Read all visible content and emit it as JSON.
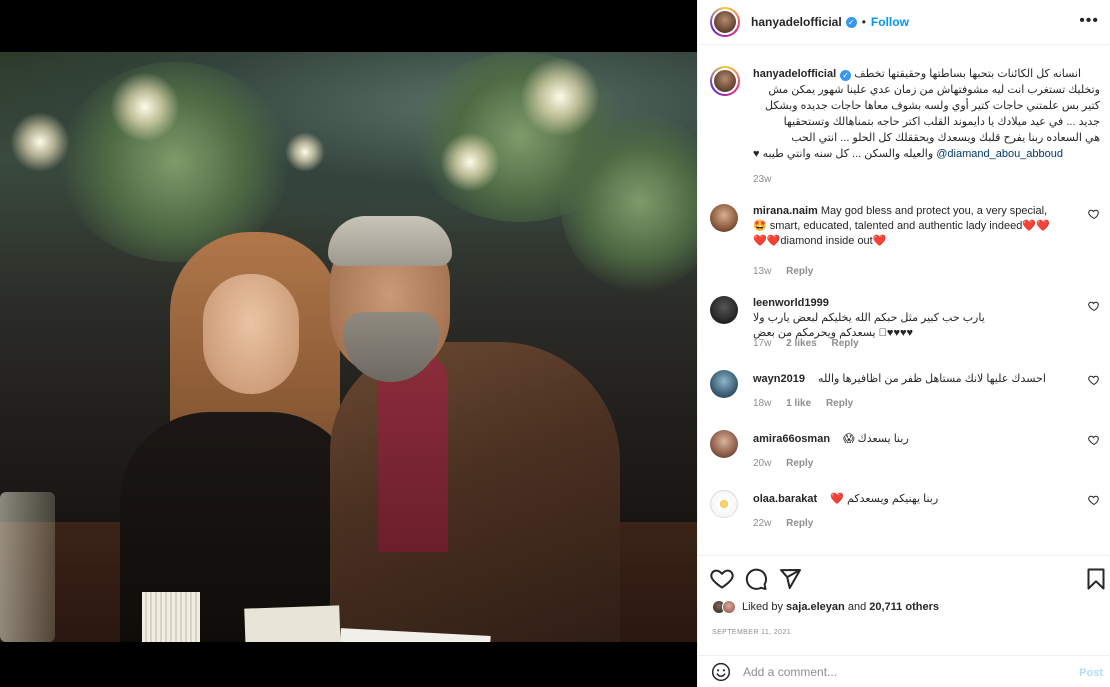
{
  "post": {
    "username": "hanyadelofficial",
    "follow_label": "Follow",
    "separator": "•",
    "more_label": "•••",
    "verified_mark": "✓"
  },
  "caption": {
    "username": "hanyadelofficial",
    "lines": [
      "انسانه كل الكائنات بتحبها بساطتها وحقيقتها تخطف",
      "وتخليك تستغرب انت ليه مشوفتهاش من زمان عدي علينا شهور يمكن مش",
      "كتير بس علمتني حاجات كتير أوي ولسه بشوف معاها حاجات جديده وبشكل",
      "جديد ... في عيد ميلادك يا دايموند القلب اكتر حاجه بتمناهالك وتستحقيها",
      "هي السعاده ربنا يفرح قلبك ويسعدك ويحققلك كل الحلو ... انتي الحب"
    ],
    "last_line_text": "والعيله والسكن ... كل سنه وانتي طيبه ♥",
    "mention": "@diamand_abou_abboud",
    "time": "23w"
  },
  "comments": [
    {
      "username": "mirana.naim",
      "text_1": "May god bless and protect you, a very special,",
      "text_2": "🤩 smart, educated, talented and authentic lady indeed❤️❤️",
      "text_3": "❤️❤️diamond inside out❤️",
      "time": "13w",
      "likes": "",
      "reply": "Reply"
    },
    {
      "username": "leenworld1999",
      "text_1": "يارب حب كبير مثل حبكم الله يخليكم لبعض يارب ولا",
      "text_2": "♥♥♥♥🏻 يسعدكم ويحرمكم من بعض",
      "time": "17w",
      "likes": "2 likes",
      "reply": "Reply"
    },
    {
      "username": "wayn2019",
      "text_1": "احسدك عليها لانك مستاهل ظفر من اظافيرها والله",
      "time": "18w",
      "likes": "1 like",
      "reply": "Reply"
    },
    {
      "username": "amira66osman",
      "text_1": "ربنا يسعدك 😱",
      "time": "20w",
      "likes": "",
      "reply": "Reply"
    },
    {
      "username": "olaa.barakat",
      "text_1": "ربنا يهنيكم ويسعدكم ❤️",
      "time": "22w",
      "likes": "",
      "reply": "Reply"
    }
  ],
  "likes": {
    "prefix": "Liked by",
    "user": "saja.eleyan",
    "middle": "and",
    "count": "20,711 others"
  },
  "date": "SEPTEMBER 11, 2021",
  "add_comment": {
    "placeholder": "Add a comment...",
    "post_label": "Post"
  },
  "icons": {
    "like": "heart-icon",
    "comment": "comment-icon",
    "share": "share-icon",
    "save": "bookmark-icon",
    "emoji": "emoji-icon",
    "comment_like": "small-heart-icon"
  },
  "colors": {
    "follow": "#0095f6",
    "verified": "#3897f0",
    "meta": "#8e8e8e",
    "post_disabled": "#b3dbff"
  }
}
